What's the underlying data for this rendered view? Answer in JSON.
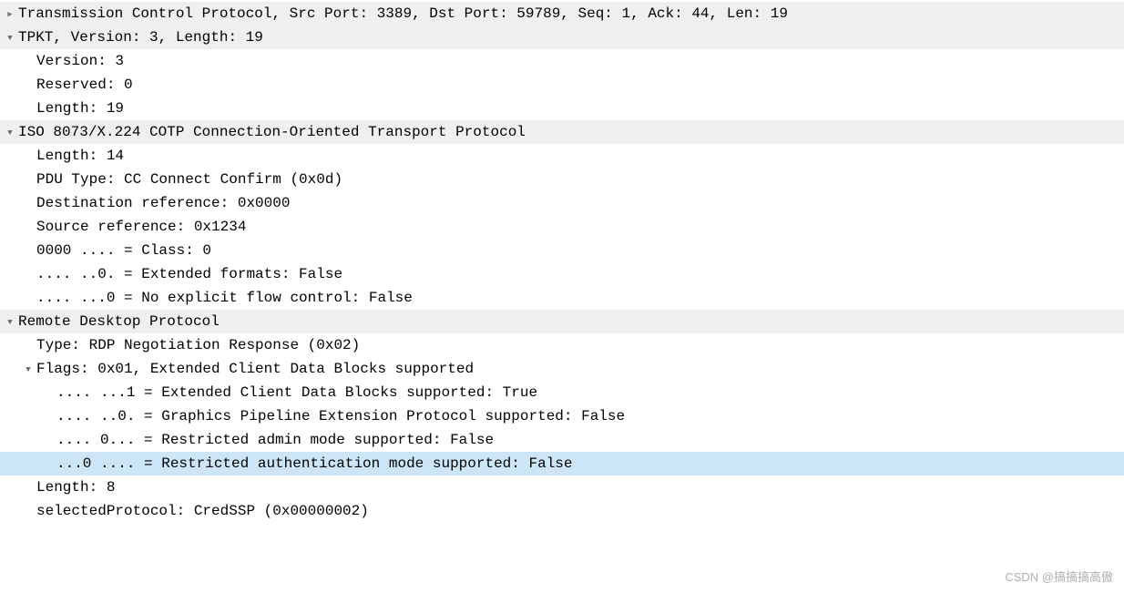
{
  "tcp": {
    "summary": "Transmission Control Protocol, Src Port: 3389, Dst Port: 59789, Seq: 1, Ack: 44, Len: 19"
  },
  "tpkt": {
    "summary": "TPKT, Version: 3, Length: 19",
    "version": "Version: 3",
    "reserved": "Reserved: 0",
    "length": "Length: 19"
  },
  "cotp": {
    "summary": "ISO 8073/X.224 COTP Connection-Oriented Transport Protocol",
    "length": "Length: 14",
    "pdu_type": "PDU Type: CC Connect Confirm (0x0d)",
    "dst_ref": "Destination reference: 0x0000",
    "src_ref": "Source reference: 0x1234",
    "class": "0000 .... = Class: 0",
    "ext_formats": ".... ..0. = Extended formats: False",
    "no_flow": ".... ...0 = No explicit flow control: False"
  },
  "rdp": {
    "summary": "Remote Desktop Protocol",
    "type": "Type: RDP Negotiation Response (0x02)",
    "flags_summary": "Flags: 0x01, Extended Client Data Blocks supported",
    "flag_ext_client": ".... ...1 = Extended Client Data Blocks supported: True",
    "flag_gfx": ".... ..0. = Graphics Pipeline Extension Protocol supported: False",
    "flag_restricted_admin": ".... 0... = Restricted admin mode supported: False",
    "flag_restricted_auth": "...0 .... = Restricted authentication mode supported: False",
    "length": "Length: 8",
    "selected_protocol": "selectedProtocol: CredSSP (0x00000002)"
  },
  "watermark": "CSDN @搞搞搞高傲"
}
